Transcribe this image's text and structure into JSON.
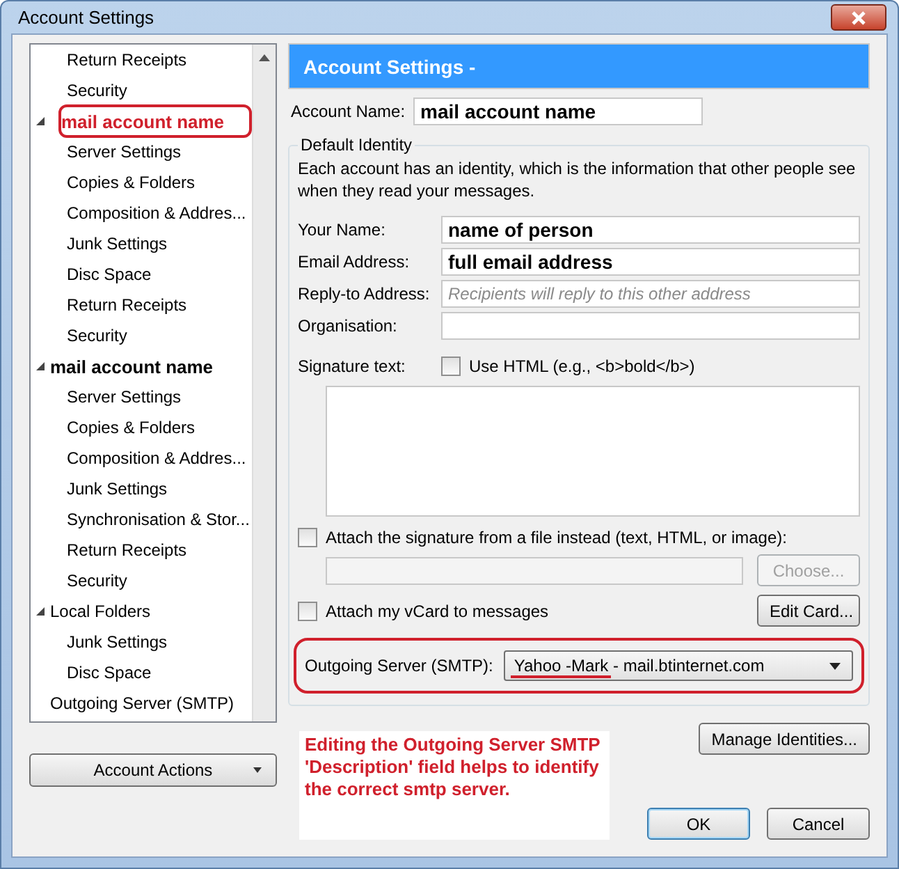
{
  "window": {
    "title": "Account Settings"
  },
  "tree": [
    {
      "label": "Return Receipts",
      "kind": "page"
    },
    {
      "label": "Security",
      "kind": "page"
    },
    {
      "label": "mail account name",
      "kind": "account",
      "expanded": true,
      "highlighted": true,
      "children": [
        {
          "label": "Server Settings",
          "kind": "page"
        },
        {
          "label": "Copies & Folders",
          "kind": "page"
        },
        {
          "label": "Composition & Addres...",
          "kind": "page"
        },
        {
          "label": "Junk Settings",
          "kind": "page"
        },
        {
          "label": "Disc Space",
          "kind": "page"
        },
        {
          "label": "Return Receipts",
          "kind": "page"
        },
        {
          "label": "Security",
          "kind": "page"
        }
      ]
    },
    {
      "label": "mail account name",
      "kind": "account",
      "expanded": true,
      "highlighted": false,
      "children": [
        {
          "label": "Server Settings",
          "kind": "page"
        },
        {
          "label": "Copies & Folders",
          "kind": "page"
        },
        {
          "label": "Composition & Addres...",
          "kind": "page"
        },
        {
          "label": "Junk Settings",
          "kind": "page"
        },
        {
          "label": "Synchronisation & Stor...",
          "kind": "page"
        },
        {
          "label": "Return Receipts",
          "kind": "page"
        },
        {
          "label": "Security",
          "kind": "page"
        }
      ]
    },
    {
      "label": "Local Folders",
      "kind": "folder",
      "expanded": true,
      "children": [
        {
          "label": "Junk Settings",
          "kind": "page"
        },
        {
          "label": "Disc Space",
          "kind": "page"
        }
      ]
    },
    {
      "label": "Outgoing Server (SMTP)",
      "kind": "server"
    }
  ],
  "account_actions": {
    "label": "Account Actions"
  },
  "header": {
    "title": "Account Settings -"
  },
  "account_name": {
    "label": "Account Name:",
    "value": "mail account name"
  },
  "identity": {
    "legend": "Default Identity",
    "description": "Each account has an identity, which is the information that other people see when they read your messages.",
    "fields": [
      {
        "label": "Your Name:",
        "value": "name of person"
      },
      {
        "label": "Email Address:",
        "value": "full email address"
      },
      {
        "label": "Reply-to Address:",
        "placeholder": "Recipients will reply to this other address"
      },
      {
        "label": "Organisation:"
      }
    ],
    "signature_label": "Signature text:",
    "use_html": {
      "label": "Use HTML (e.g., <b>bold</b>)",
      "checked": false
    },
    "attach_signature": {
      "label": "Attach the signature from a file instead (text, HTML, or image):",
      "checked": false
    },
    "choose_button": {
      "label": "Choose...",
      "disabled": true
    },
    "attach_vcard": {
      "label": "Attach my vCard to messages",
      "checked": false
    },
    "edit_card_button": {
      "label": "Edit Card..."
    },
    "smtp": {
      "label": "Outgoing Server (SMTP):",
      "value": "Yahoo -Mark - mail.btinternet.com"
    }
  },
  "manage_identities_button": {
    "label": "Manage Identities..."
  },
  "annotation": "Editing the Outgoing Server SMTP 'Description' field helps to identify the correct smtp server.",
  "buttons": [
    {
      "label": "OK",
      "default": true
    },
    {
      "label": "Cancel",
      "default": false
    }
  ]
}
